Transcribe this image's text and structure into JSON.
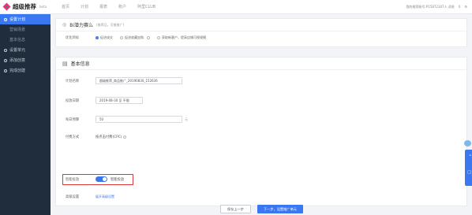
{
  "header": {
    "logo": "超级推荐",
    "beta": "beta",
    "nav": [
      "首页",
      "计划",
      "报表",
      "账户",
      "阿里CLUB"
    ],
    "user_info": "我的推荐账号:P15872347人 消息",
    "badge": "0"
  },
  "sidebar": {
    "items": [
      {
        "label": "设置计划",
        "active": true
      },
      {
        "label": "营销场景",
        "sub": true
      },
      {
        "label": "基本信息",
        "sub": true
      },
      {
        "label": "设置单元"
      },
      {
        "label": "添加创意"
      },
      {
        "label": "完成创建"
      }
    ]
  },
  "section1": {
    "title": "Bi潜力赛么",
    "subtitle": "(推荐品，可推推广)",
    "field_label": "优化目标",
    "options": [
      "促进成交",
      "促进收藏加购",
      "获取新客户，提高店铺可视规模"
    ]
  },
  "section2": {
    "title": "基本信息",
    "plan_name_label": "计划名称",
    "plan_name_value": "超级推荐_商品推广_20190830_152636",
    "date_label": "投放日期",
    "date_value": "2019-08-30 至 不限",
    "budget_label": "每日预算",
    "budget_value": "50",
    "budget_unit": "元",
    "bid_label": "付费方式",
    "bid_value": "按点击付费(CPC)",
    "smart_label": "智能投放",
    "smart_value": "智能投放",
    "advanced_label": "高级设置",
    "advanced_link": "展开高级设置"
  },
  "buttons": {
    "prev": "保存上一步",
    "next": "下一步，设置推广单元"
  }
}
